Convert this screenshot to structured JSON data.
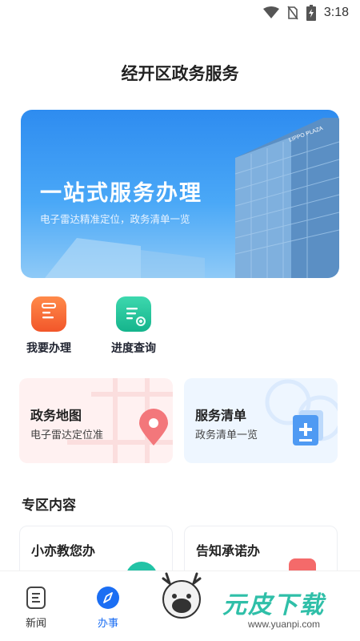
{
  "status_bar": {
    "time": "3:18",
    "icons": [
      "wifi-icon",
      "no-sim-icon",
      "battery-charging-icon"
    ]
  },
  "header": {
    "title": "经开区政务服务"
  },
  "banner": {
    "title": "一站式服务办理",
    "subtitle": "电子雷达精准定位，政务清单一览",
    "building_sign": "LIPPO PLAZA"
  },
  "quick_actions": [
    {
      "label": "我要办理",
      "icon": "briefcase-icon",
      "color": "#f26a2e"
    },
    {
      "label": "进度查询",
      "icon": "document-search-icon",
      "color": "#1fc29a"
    }
  ],
  "cards": [
    {
      "title": "政务地图",
      "subtitle": "电子雷达定位准",
      "icon": "map-pin-icon"
    },
    {
      "title": "服务清单",
      "subtitle": "政务清单一览",
      "icon": "document-add-icon"
    }
  ],
  "zone": {
    "title": "专区内容",
    "items": [
      {
        "title": "小亦教您办"
      },
      {
        "title": "告知承诺办"
      }
    ]
  },
  "tabbar": {
    "items": [
      {
        "label": "新闻",
        "icon": "news-icon",
        "active": false
      },
      {
        "label": "办事",
        "icon": "compass-icon",
        "active": true
      }
    ]
  },
  "watermark": {
    "main": "元皮下载",
    "url": "www.yuanpi.com"
  },
  "colors": {
    "accent": "#1b6ef3",
    "banner": "#3a9af3",
    "orange": "#f26a2e",
    "green": "#1fc29a"
  }
}
